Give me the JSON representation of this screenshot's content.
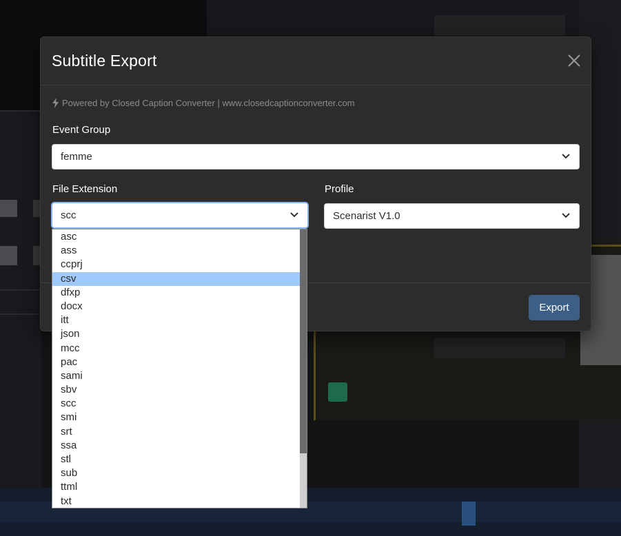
{
  "modal": {
    "title": "Subtitle Export",
    "powered_by": "Powered by Closed Caption Converter | www.closedcaptionconverter.com",
    "event_group": {
      "label": "Event Group",
      "value": "femme"
    },
    "file_extension": {
      "label": "File Extension",
      "value": "scc"
    },
    "profile": {
      "label": "Profile",
      "value": "Scenarist V1.0"
    },
    "export_label": "Export"
  },
  "dropdown": {
    "items": [
      "asc",
      "ass",
      "ccprj",
      "csv",
      "dfxp",
      "docx",
      "itt",
      "json",
      "mcc",
      "pac",
      "sami",
      "sbv",
      "scc",
      "smi",
      "srt",
      "ssa",
      "stl",
      "sub",
      "ttml",
      "txt"
    ],
    "highlighted": "csv"
  },
  "colors": {
    "accent_button": "#3c5f87",
    "highlight": "#9fcafb",
    "modal_bg": "#2c2c2c"
  },
  "icons": {
    "powered": "bolt-icon",
    "close": "close-icon",
    "select": "chevron-down-icon"
  }
}
